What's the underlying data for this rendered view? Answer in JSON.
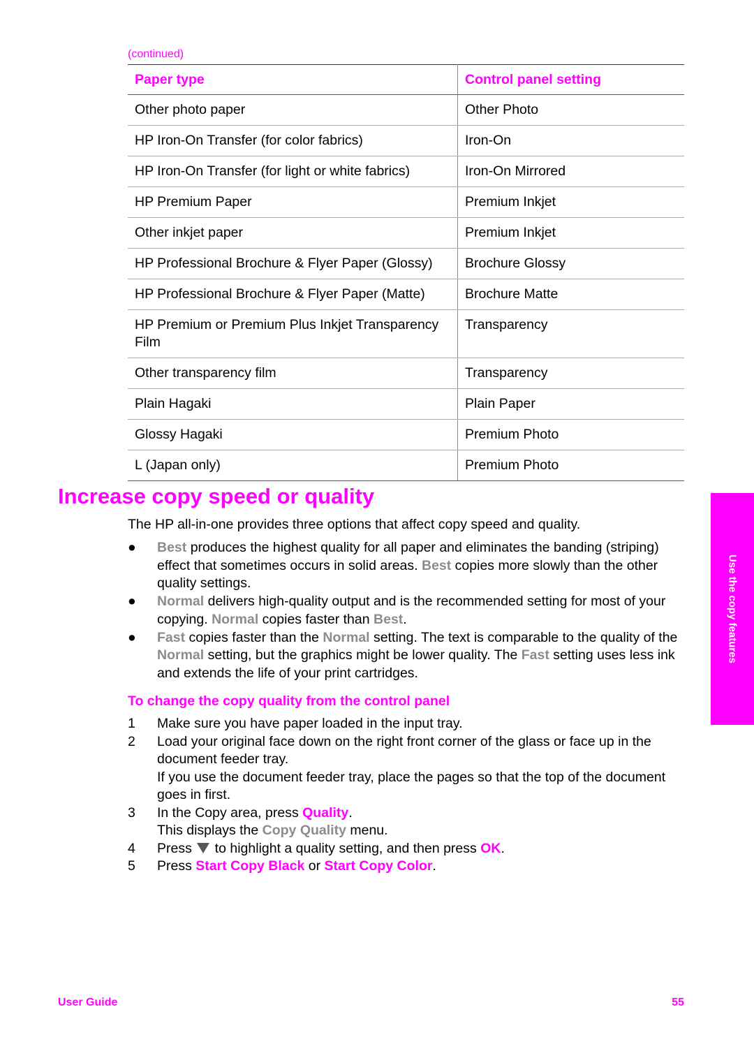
{
  "continued_label": "(continued)",
  "table": {
    "headers": [
      "Paper type",
      "Control panel setting"
    ],
    "rows": [
      [
        "Other photo paper",
        "Other Photo"
      ],
      [
        "HP Iron-On Transfer (for color fabrics)",
        "Iron-On"
      ],
      [
        "HP Iron-On Transfer (for light or white fabrics)",
        "Iron-On Mirrored"
      ],
      [
        "HP Premium Paper",
        "Premium Inkjet"
      ],
      [
        "Other inkjet paper",
        "Premium Inkjet"
      ],
      [
        "HP Professional Brochure & Flyer Paper (Glossy)",
        "Brochure Glossy"
      ],
      [
        "HP Professional Brochure & Flyer Paper (Matte)",
        "Brochure Matte"
      ],
      [
        "HP Premium or Premium Plus Inkjet Transparency Film",
        "Transparency"
      ],
      [
        "Other transparency film",
        "Transparency"
      ],
      [
        "Plain Hagaki",
        "Plain Paper"
      ],
      [
        "Glossy Hagaki",
        "Premium Photo"
      ],
      [
        "L (Japan only)",
        "Premium Photo"
      ]
    ]
  },
  "section": {
    "title": "Increase copy speed or quality",
    "intro": "The HP all-in-one provides three options that affect copy speed and quality.",
    "bullet_glyph": "●",
    "bullets": [
      {
        "parts": [
          {
            "t": "Best",
            "s": "gray"
          },
          {
            "t": " produces the highest quality for all paper and eliminates the banding (striping) effect that sometimes occurs in solid areas. "
          },
          {
            "t": "Best",
            "s": "gray"
          },
          {
            "t": " copies more slowly than the other quality settings."
          }
        ]
      },
      {
        "parts": [
          {
            "t": "Normal",
            "s": "gray"
          },
          {
            "t": " delivers high-quality output and is the recommended setting for most of your copying. "
          },
          {
            "t": "Normal",
            "s": "gray"
          },
          {
            "t": " copies faster than "
          },
          {
            "t": "Best",
            "s": "gray"
          },
          {
            "t": "."
          }
        ]
      },
      {
        "parts": [
          {
            "t": "Fast",
            "s": "gray"
          },
          {
            "t": " copies faster than the "
          },
          {
            "t": "Normal",
            "s": "gray"
          },
          {
            "t": " setting. The text is comparable to the quality of the "
          },
          {
            "t": "Normal",
            "s": "gray"
          },
          {
            "t": " setting, but the graphics might be lower quality. The "
          },
          {
            "t": "Fast",
            "s": "gray"
          },
          {
            "t": " setting uses less ink and extends the life of your print cartridges."
          }
        ]
      }
    ]
  },
  "procedure": {
    "title": "To change the copy quality from the control panel",
    "steps": [
      {
        "num": "1",
        "lines": [
          [
            {
              "t": "Make sure you have paper loaded in the input tray."
            }
          ]
        ]
      },
      {
        "num": "2",
        "lines": [
          [
            {
              "t": "Load your original face down on the right front corner of the glass or face up in the document feeder tray."
            }
          ],
          [
            {
              "t": "If you use the document feeder tray, place the pages so that the top of the document goes in first."
            }
          ]
        ]
      },
      {
        "num": "3",
        "lines": [
          [
            {
              "t": "In the Copy area, press "
            },
            {
              "t": "Quality",
              "s": "pink"
            },
            {
              "t": "."
            }
          ],
          [
            {
              "t": "This displays the "
            },
            {
              "t": "Copy Quality",
              "s": "gray"
            },
            {
              "t": " menu."
            }
          ]
        ]
      },
      {
        "num": "4",
        "lines": [
          [
            {
              "t": "Press "
            },
            {
              "icon": "down-arrow-icon"
            },
            {
              "t": " to highlight a quality setting, and then press "
            },
            {
              "t": "OK",
              "s": "pink"
            },
            {
              "t": "."
            }
          ]
        ]
      },
      {
        "num": "5",
        "lines": [
          [
            {
              "t": "Press "
            },
            {
              "t": "Start Copy Black",
              "s": "pink"
            },
            {
              "t": " or "
            },
            {
              "t": "Start Copy Color",
              "s": "pink"
            },
            {
              "t": "."
            }
          ]
        ]
      }
    ]
  },
  "side_tab": "Use the copy features",
  "footer": {
    "left": "User Guide",
    "page_number": "55"
  },
  "colors": {
    "accent": "#ff00ff",
    "ui_term": "#8c8c8c"
  }
}
